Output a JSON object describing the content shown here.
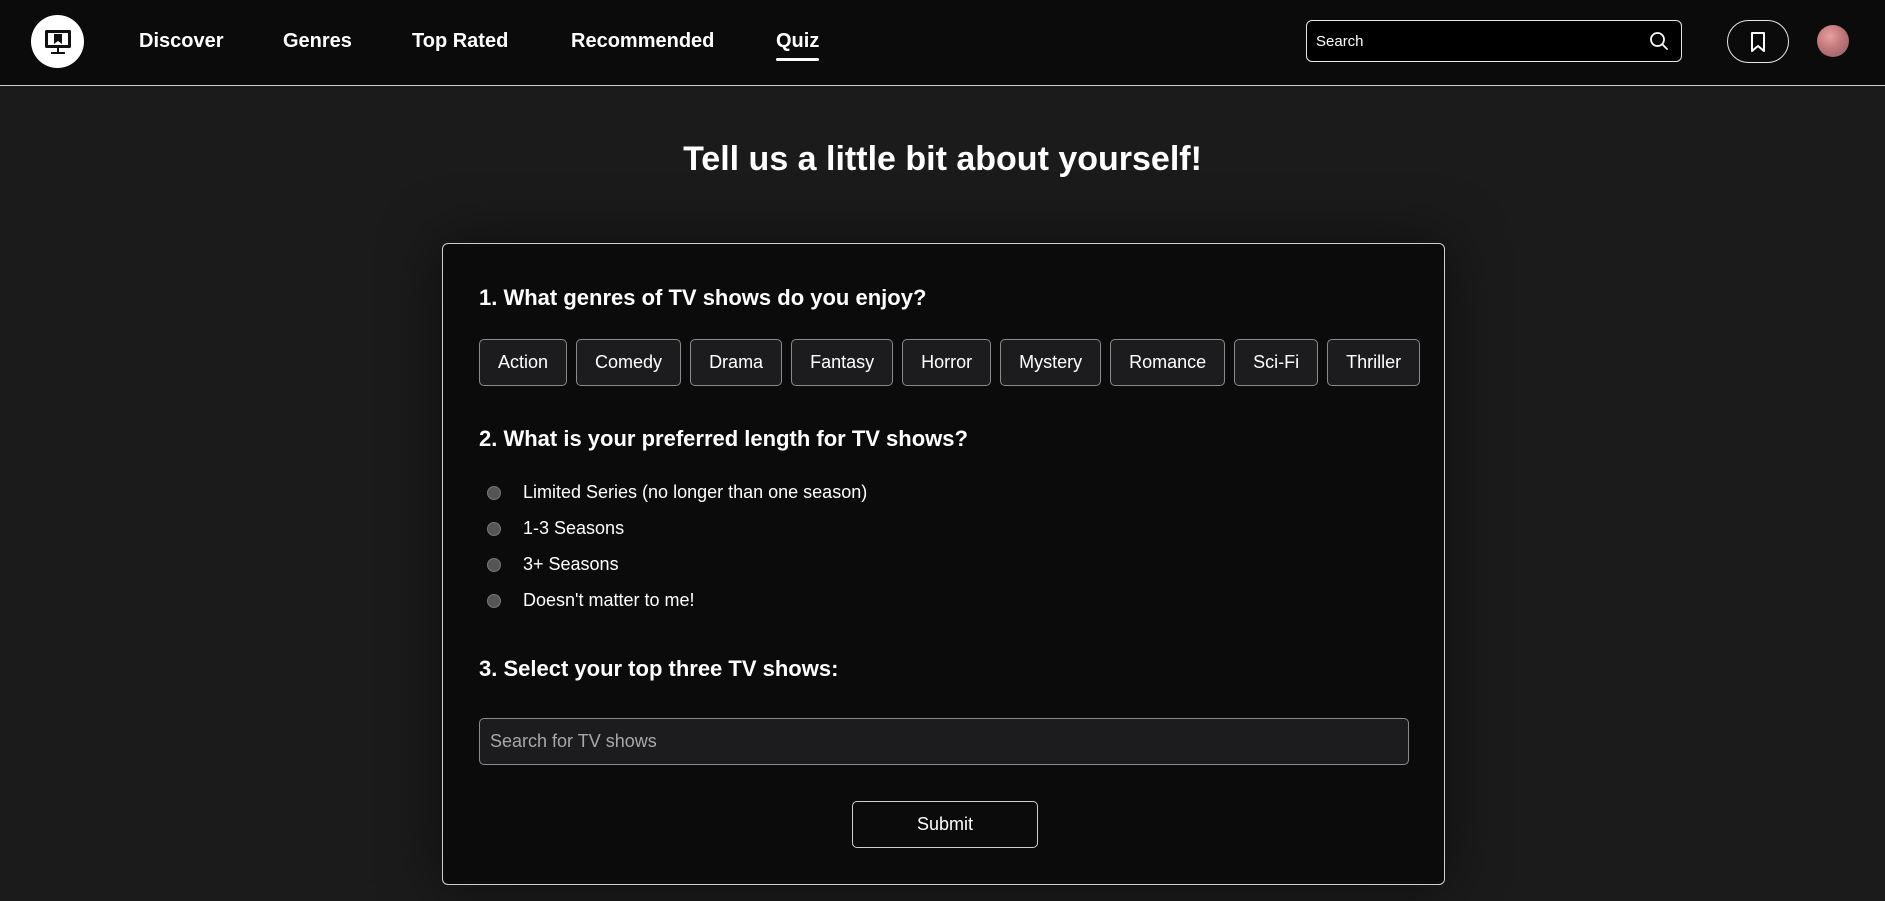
{
  "nav": {
    "logo_icon": "tv-monitor-icon",
    "links": [
      {
        "label": "Discover"
      },
      {
        "label": "Genres"
      },
      {
        "label": "Top Rated"
      },
      {
        "label": "Recommended"
      },
      {
        "label": "Quiz",
        "active": true
      }
    ],
    "search_placeholder": "Search",
    "search_icon": "search-icon",
    "bookmark_icon": "bookmark-icon"
  },
  "page": {
    "title": "Tell us a little bit about yourself!"
  },
  "quiz": {
    "q1": {
      "text": "1. What genres of TV shows do you enjoy?",
      "options": [
        "Action",
        "Comedy",
        "Drama",
        "Fantasy",
        "Horror",
        "Mystery",
        "Romance",
        "Sci-Fi",
        "Thriller"
      ]
    },
    "q2": {
      "text": "2. What is your preferred length for TV shows?",
      "options": [
        "Limited Series (no longer than one season)",
        "1-3 Seasons",
        "3+ Seasons",
        "Doesn't matter to me!"
      ]
    },
    "q3": {
      "text": "3. Select your top three TV shows:",
      "placeholder": "Search for TV shows"
    },
    "submit_label": "Submit"
  },
  "colors": {
    "background": "#1b1b1b",
    "navbar": "#0b0b0c",
    "card": "#0b0b0c",
    "button_fill": "#1c1c1e",
    "text": "#ffffff"
  }
}
